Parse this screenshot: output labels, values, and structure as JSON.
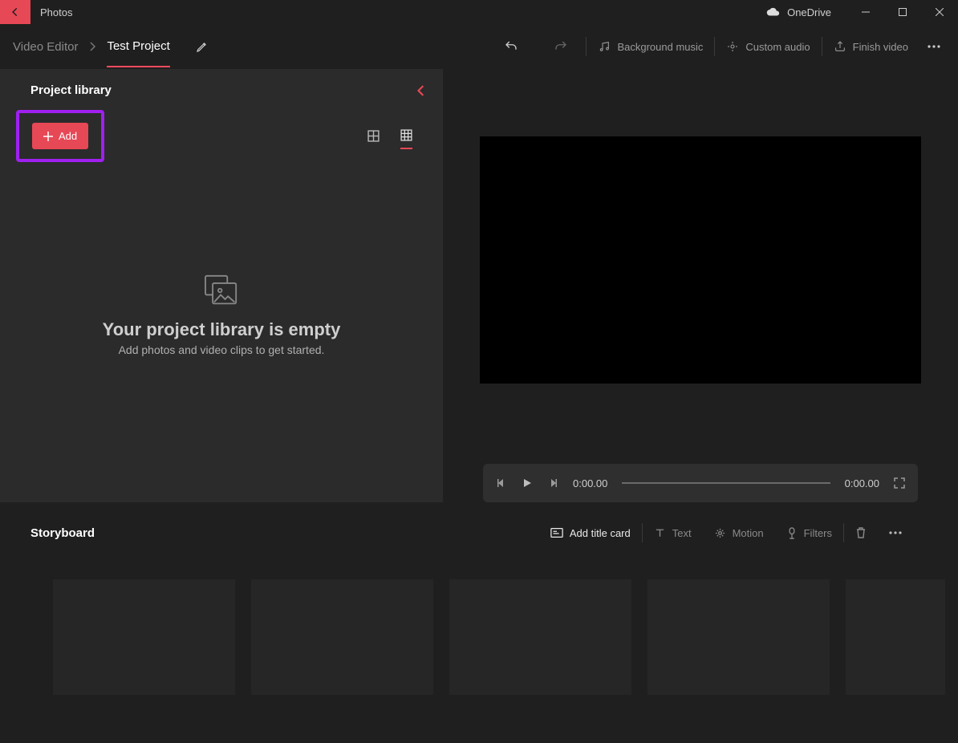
{
  "titlebar": {
    "app_name": "Photos",
    "onedrive_label": "OneDrive"
  },
  "breadcrumb": {
    "root": "Video Editor",
    "project": "Test Project"
  },
  "toolbar": {
    "background_music": "Background music",
    "custom_audio": "Custom audio",
    "finish_video": "Finish video"
  },
  "library": {
    "title": "Project library",
    "add_label": "Add",
    "empty_title": "Your project library is empty",
    "empty_sub": "Add photos and video clips to get started."
  },
  "player": {
    "time_current": "0:00.00",
    "time_total": "0:00.00"
  },
  "storyboard": {
    "title": "Storyboard",
    "add_title_card": "Add title card",
    "text": "Text",
    "motion": "Motion",
    "filters": "Filters"
  }
}
